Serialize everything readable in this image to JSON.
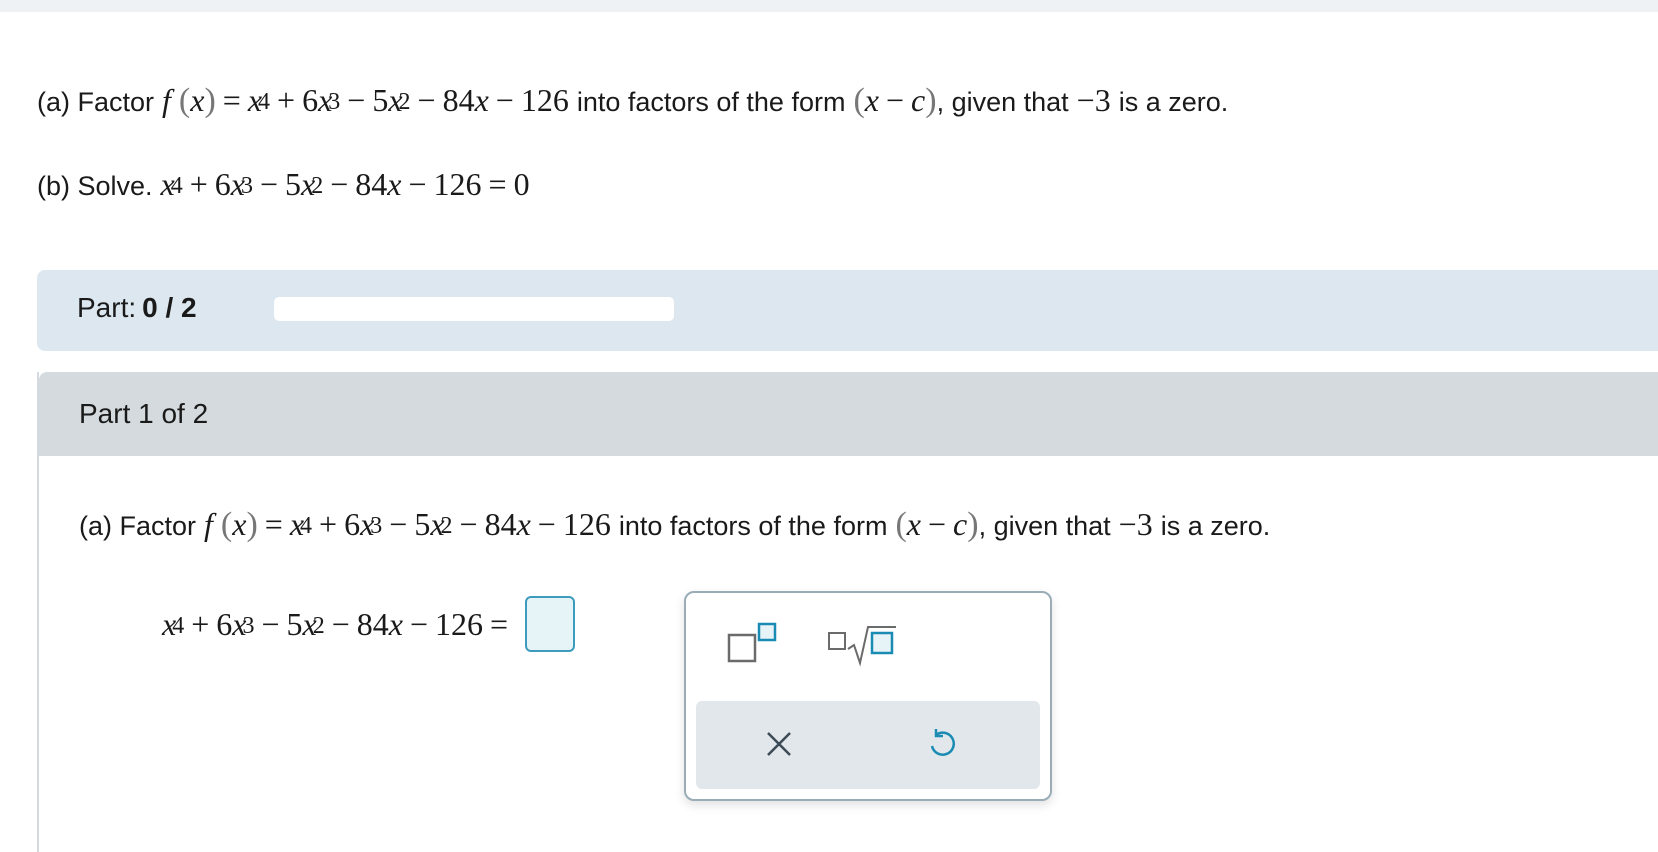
{
  "problem": {
    "a_prefix": "(a) Factor",
    "a_mid": "into factors of the form",
    "a_suffix_1": ", given that",
    "a_suffix_2": "is a zero.",
    "b_prefix": "(b) Solve.",
    "zero_value": "−3",
    "coef_6x": "6",
    "coef_5x": "5",
    "coef_84": "84",
    "const_126": "126",
    "rhs_zero": "0"
  },
  "progress": {
    "label": "Part:",
    "value_text": "0 / 2",
    "fraction_complete": 0
  },
  "part": {
    "header": "Part 1 of 2"
  },
  "palette": {
    "superscript_icon": "superscript-template-icon",
    "sqrt_icon": "nth-root-template-icon",
    "clear_icon": "close-x-icon",
    "undo_icon": "undo-icon"
  },
  "colors": {
    "accent": "#3d9cbd",
    "part_bar": "#dce7ef",
    "part_header": "#d4dadd"
  }
}
